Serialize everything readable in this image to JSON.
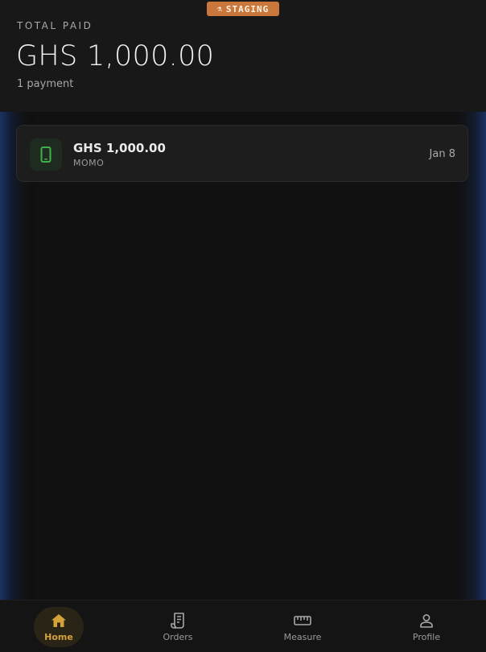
{
  "env_badge": {
    "label": "STAGING",
    "icon": "flask-icon"
  },
  "summary": {
    "label": "TOTAL PAID",
    "amount": "GHS 1,000.00",
    "count": "1 payment"
  },
  "payments": [
    {
      "amount": "GHS 1,000.00",
      "method": "MOMO",
      "date": "Jan 8",
      "icon": "phone-icon"
    }
  ],
  "nav": {
    "items": [
      {
        "label": "Home",
        "icon": "home-icon",
        "active": true
      },
      {
        "label": "Orders",
        "icon": "receipt-icon",
        "active": false
      },
      {
        "label": "Measure",
        "icon": "ruler-icon",
        "active": false
      },
      {
        "label": "Profile",
        "icon": "person-icon",
        "active": false
      }
    ]
  },
  "colors": {
    "accent": "#d4a23a",
    "badge": "#c9773a",
    "momo_green": "#3fb24a",
    "frame_glow": "#285abe"
  }
}
